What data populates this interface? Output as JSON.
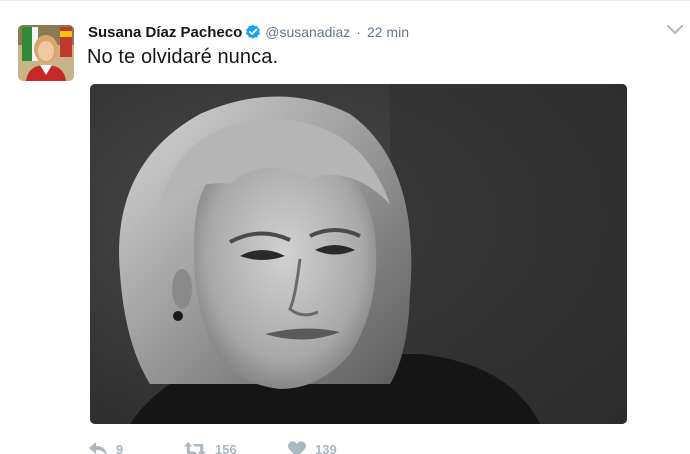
{
  "tweet": {
    "author": {
      "display_name": "Susana Díaz Pacheco",
      "handle": "@susanadiaz",
      "verified": true
    },
    "separator": "·",
    "time": "22 min",
    "text": "No te olvidaré nunca.",
    "actions": {
      "reply_count": "9",
      "retweet_count": "156",
      "like_count": "139"
    }
  },
  "colors": {
    "name": "#14171a",
    "meta": "#657786",
    "verified_badge": "#1da1f2",
    "action_icons": "#aab8c2"
  },
  "icons": {
    "reply": "reply-icon",
    "retweet": "retweet-icon",
    "like": "heart-icon",
    "more": "chevron-down-icon",
    "verified": "verified-badge-icon"
  }
}
